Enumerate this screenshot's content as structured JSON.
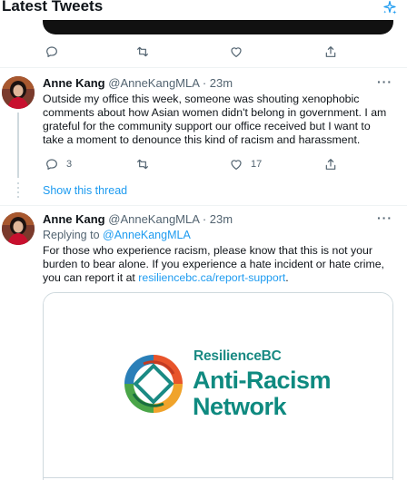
{
  "header": {
    "title": "Latest Tweets",
    "icon": "sparkle-icon"
  },
  "accent_color": "#1d9bf0",
  "tweets": [
    {
      "name": "Anne Kang",
      "handle": "@AnneKangMLA",
      "separator": "·",
      "time": "23m",
      "text": "Outside my office this week, someone was shouting xenophobic comments about how Asian women didn't belong in government. I am grateful for the community support our office received but I want to take a moment to denounce this kind of racism and harassment.",
      "reply_count": "3",
      "retweet_count": "",
      "like_count": "17"
    },
    {
      "name": "Anne Kang",
      "handle": "@AnneKangMLA",
      "separator": "·",
      "time": "23m",
      "replying_prefix": "Replying to ",
      "replying_to": "@AnneKangMLA",
      "text_before_link": "For those who experience racism, please know that this is not your burden to bear alone. If you experience a hate incident or hate crime, you can report it at ",
      "link": "resiliencebc.ca/report-support",
      "text_after_link": ".",
      "card": {
        "brand": "ResilienceBC",
        "line1": "Anti-Racism",
        "line2": "Network"
      }
    }
  ],
  "show_thread": "Show this thread"
}
